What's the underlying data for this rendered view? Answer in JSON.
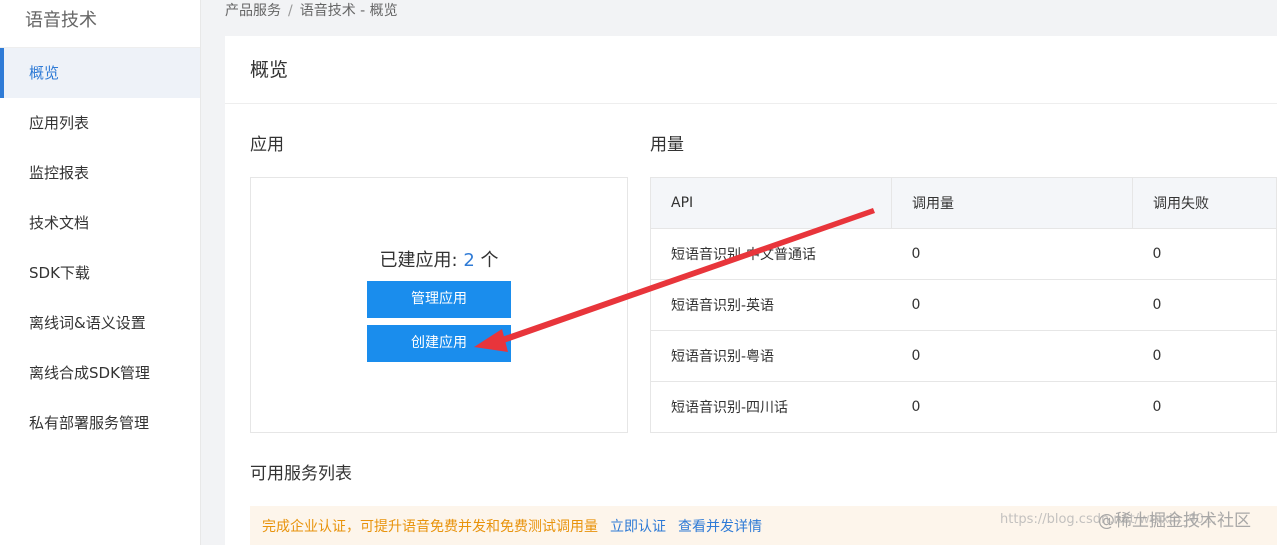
{
  "sidebar": {
    "title": "语音技术",
    "items": [
      {
        "label": "概览",
        "active": true
      },
      {
        "label": "应用列表"
      },
      {
        "label": "监控报表"
      },
      {
        "label": "技术文档"
      },
      {
        "label": "SDK下载"
      },
      {
        "label": "离线词&语义设置"
      },
      {
        "label": "离线合成SDK管理"
      },
      {
        "label": "私有部署服务管理"
      }
    ]
  },
  "breadcrumb": {
    "root": "产品服务",
    "separator": "/",
    "current": "语音技术 - 概览"
  },
  "page": {
    "title": "概览"
  },
  "apps": {
    "section_title": "应用",
    "count_label": "已建应用:",
    "count_value": "2",
    "count_unit": "个",
    "manage_button": "管理应用",
    "create_button": "创建应用"
  },
  "usage": {
    "section_title": "用量",
    "headers": [
      "API",
      "调用量",
      "调用失败"
    ],
    "rows": [
      [
        "短语音识别-中文普通话",
        "0",
        "0"
      ],
      [
        "短语音识别-英语",
        "0",
        "0"
      ],
      [
        "短语音识别-粤语",
        "0",
        "0"
      ],
      [
        "短语音识别-四川话",
        "0",
        "0"
      ]
    ]
  },
  "services": {
    "section_title": "可用服务列表"
  },
  "notice": {
    "text": "完成企业认证，可提升语音免费并发和免费测试调用量",
    "link_verify": "立即认证",
    "link_details": "查看并发详情"
  },
  "watermark": {
    "url_text": "https://blog.csdn.net/weixin_40...",
    "site_text": "@稀土掘金技术社区"
  },
  "colors": {
    "accent": "#2f7bd6",
    "button": "#1a8ded",
    "warning": "#e8930c",
    "annotation_arrow": "#e8353b"
  }
}
